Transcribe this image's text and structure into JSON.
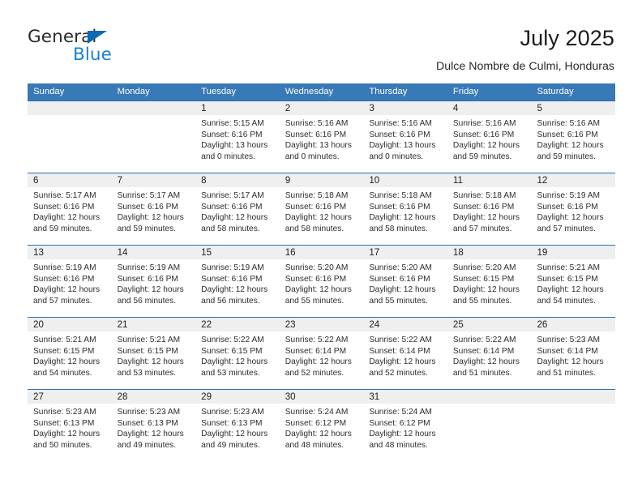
{
  "brand": {
    "name_primary": "General",
    "name_secondary": "Blue",
    "triangle_color": "#0d6bb5",
    "secondary_color": "#1b81d4"
  },
  "header": {
    "title": "July 2025",
    "subtitle": "Dulce Nombre de Culmi, Honduras"
  },
  "theme": {
    "header_bg": "#3879b7",
    "header_text": "#ffffff",
    "row_divider": "#2a6dae",
    "day_band_bg": "#efefef"
  },
  "weekdays": [
    "Sunday",
    "Monday",
    "Tuesday",
    "Wednesday",
    "Thursday",
    "Friday",
    "Saturday"
  ],
  "weeks": [
    [
      {
        "day": "",
        "sunrise": "",
        "sunset": "",
        "daylight_line1": "",
        "daylight_line2": ""
      },
      {
        "day": "",
        "sunrise": "",
        "sunset": "",
        "daylight_line1": "",
        "daylight_line2": ""
      },
      {
        "day": "1",
        "sunrise": "Sunrise: 5:15 AM",
        "sunset": "Sunset: 6:16 PM",
        "daylight_line1": "Daylight: 13 hours",
        "daylight_line2": "and 0 minutes."
      },
      {
        "day": "2",
        "sunrise": "Sunrise: 5:16 AM",
        "sunset": "Sunset: 6:16 PM",
        "daylight_line1": "Daylight: 13 hours",
        "daylight_line2": "and 0 minutes."
      },
      {
        "day": "3",
        "sunrise": "Sunrise: 5:16 AM",
        "sunset": "Sunset: 6:16 PM",
        "daylight_line1": "Daylight: 13 hours",
        "daylight_line2": "and 0 minutes."
      },
      {
        "day": "4",
        "sunrise": "Sunrise: 5:16 AM",
        "sunset": "Sunset: 6:16 PM",
        "daylight_line1": "Daylight: 12 hours",
        "daylight_line2": "and 59 minutes."
      },
      {
        "day": "5",
        "sunrise": "Sunrise: 5:16 AM",
        "sunset": "Sunset: 6:16 PM",
        "daylight_line1": "Daylight: 12 hours",
        "daylight_line2": "and 59 minutes."
      }
    ],
    [
      {
        "day": "6",
        "sunrise": "Sunrise: 5:17 AM",
        "sunset": "Sunset: 6:16 PM",
        "daylight_line1": "Daylight: 12 hours",
        "daylight_line2": "and 59 minutes."
      },
      {
        "day": "7",
        "sunrise": "Sunrise: 5:17 AM",
        "sunset": "Sunset: 6:16 PM",
        "daylight_line1": "Daylight: 12 hours",
        "daylight_line2": "and 59 minutes."
      },
      {
        "day": "8",
        "sunrise": "Sunrise: 5:17 AM",
        "sunset": "Sunset: 6:16 PM",
        "daylight_line1": "Daylight: 12 hours",
        "daylight_line2": "and 58 minutes."
      },
      {
        "day": "9",
        "sunrise": "Sunrise: 5:18 AM",
        "sunset": "Sunset: 6:16 PM",
        "daylight_line1": "Daylight: 12 hours",
        "daylight_line2": "and 58 minutes."
      },
      {
        "day": "10",
        "sunrise": "Sunrise: 5:18 AM",
        "sunset": "Sunset: 6:16 PM",
        "daylight_line1": "Daylight: 12 hours",
        "daylight_line2": "and 58 minutes."
      },
      {
        "day": "11",
        "sunrise": "Sunrise: 5:18 AM",
        "sunset": "Sunset: 6:16 PM",
        "daylight_line1": "Daylight: 12 hours",
        "daylight_line2": "and 57 minutes."
      },
      {
        "day": "12",
        "sunrise": "Sunrise: 5:19 AM",
        "sunset": "Sunset: 6:16 PM",
        "daylight_line1": "Daylight: 12 hours",
        "daylight_line2": "and 57 minutes."
      }
    ],
    [
      {
        "day": "13",
        "sunrise": "Sunrise: 5:19 AM",
        "sunset": "Sunset: 6:16 PM",
        "daylight_line1": "Daylight: 12 hours",
        "daylight_line2": "and 57 minutes."
      },
      {
        "day": "14",
        "sunrise": "Sunrise: 5:19 AM",
        "sunset": "Sunset: 6:16 PM",
        "daylight_line1": "Daylight: 12 hours",
        "daylight_line2": "and 56 minutes."
      },
      {
        "day": "15",
        "sunrise": "Sunrise: 5:19 AM",
        "sunset": "Sunset: 6:16 PM",
        "daylight_line1": "Daylight: 12 hours",
        "daylight_line2": "and 56 minutes."
      },
      {
        "day": "16",
        "sunrise": "Sunrise: 5:20 AM",
        "sunset": "Sunset: 6:16 PM",
        "daylight_line1": "Daylight: 12 hours",
        "daylight_line2": "and 55 minutes."
      },
      {
        "day": "17",
        "sunrise": "Sunrise: 5:20 AM",
        "sunset": "Sunset: 6:16 PM",
        "daylight_line1": "Daylight: 12 hours",
        "daylight_line2": "and 55 minutes."
      },
      {
        "day": "18",
        "sunrise": "Sunrise: 5:20 AM",
        "sunset": "Sunset: 6:15 PM",
        "daylight_line1": "Daylight: 12 hours",
        "daylight_line2": "and 55 minutes."
      },
      {
        "day": "19",
        "sunrise": "Sunrise: 5:21 AM",
        "sunset": "Sunset: 6:15 PM",
        "daylight_line1": "Daylight: 12 hours",
        "daylight_line2": "and 54 minutes."
      }
    ],
    [
      {
        "day": "20",
        "sunrise": "Sunrise: 5:21 AM",
        "sunset": "Sunset: 6:15 PM",
        "daylight_line1": "Daylight: 12 hours",
        "daylight_line2": "and 54 minutes."
      },
      {
        "day": "21",
        "sunrise": "Sunrise: 5:21 AM",
        "sunset": "Sunset: 6:15 PM",
        "daylight_line1": "Daylight: 12 hours",
        "daylight_line2": "and 53 minutes."
      },
      {
        "day": "22",
        "sunrise": "Sunrise: 5:22 AM",
        "sunset": "Sunset: 6:15 PM",
        "daylight_line1": "Daylight: 12 hours",
        "daylight_line2": "and 53 minutes."
      },
      {
        "day": "23",
        "sunrise": "Sunrise: 5:22 AM",
        "sunset": "Sunset: 6:14 PM",
        "daylight_line1": "Daylight: 12 hours",
        "daylight_line2": "and 52 minutes."
      },
      {
        "day": "24",
        "sunrise": "Sunrise: 5:22 AM",
        "sunset": "Sunset: 6:14 PM",
        "daylight_line1": "Daylight: 12 hours",
        "daylight_line2": "and 52 minutes."
      },
      {
        "day": "25",
        "sunrise": "Sunrise: 5:22 AM",
        "sunset": "Sunset: 6:14 PM",
        "daylight_line1": "Daylight: 12 hours",
        "daylight_line2": "and 51 minutes."
      },
      {
        "day": "26",
        "sunrise": "Sunrise: 5:23 AM",
        "sunset": "Sunset: 6:14 PM",
        "daylight_line1": "Daylight: 12 hours",
        "daylight_line2": "and 51 minutes."
      }
    ],
    [
      {
        "day": "27",
        "sunrise": "Sunrise: 5:23 AM",
        "sunset": "Sunset: 6:13 PM",
        "daylight_line1": "Daylight: 12 hours",
        "daylight_line2": "and 50 minutes."
      },
      {
        "day": "28",
        "sunrise": "Sunrise: 5:23 AM",
        "sunset": "Sunset: 6:13 PM",
        "daylight_line1": "Daylight: 12 hours",
        "daylight_line2": "and 49 minutes."
      },
      {
        "day": "29",
        "sunrise": "Sunrise: 5:23 AM",
        "sunset": "Sunset: 6:13 PM",
        "daylight_line1": "Daylight: 12 hours",
        "daylight_line2": "and 49 minutes."
      },
      {
        "day": "30",
        "sunrise": "Sunrise: 5:24 AM",
        "sunset": "Sunset: 6:12 PM",
        "daylight_line1": "Daylight: 12 hours",
        "daylight_line2": "and 48 minutes."
      },
      {
        "day": "31",
        "sunrise": "Sunrise: 5:24 AM",
        "sunset": "Sunset: 6:12 PM",
        "daylight_line1": "Daylight: 12 hours",
        "daylight_line2": "and 48 minutes."
      },
      {
        "day": "",
        "sunrise": "",
        "sunset": "",
        "daylight_line1": "",
        "daylight_line2": ""
      },
      {
        "day": "",
        "sunrise": "",
        "sunset": "",
        "daylight_line1": "",
        "daylight_line2": ""
      }
    ]
  ]
}
